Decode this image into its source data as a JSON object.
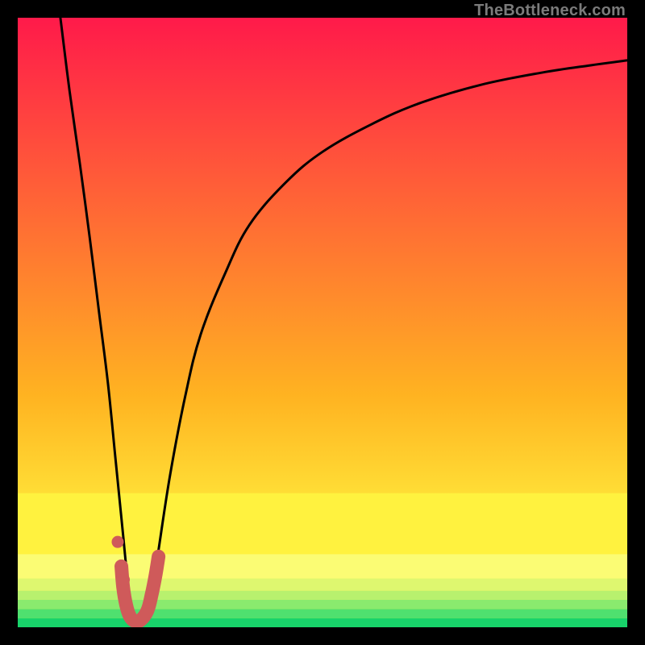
{
  "watermark": "TheBottleneck.com",
  "chart_data": {
    "type": "line",
    "title": "",
    "xlabel": "",
    "ylabel": "",
    "xlim": [
      0,
      100
    ],
    "ylim": [
      0,
      100
    ],
    "grid": false,
    "legend": false,
    "series": [
      {
        "name": "left-branch",
        "x": [
          7,
          8.5,
          10.2,
          11.8,
          13.3,
          14.8,
          16.0,
          17.2,
          18.0,
          18.8
        ],
        "y": [
          100,
          88,
          76,
          64,
          52,
          40,
          28,
          16,
          8,
          2
        ]
      },
      {
        "name": "right-branch",
        "x": [
          21.5,
          23,
          25,
          27.5,
          30,
          34,
          38,
          44,
          50,
          58,
          66,
          76,
          86,
          94,
          100
        ],
        "y": [
          2,
          12,
          25,
          38,
          48,
          58,
          66,
          73,
          78,
          82.5,
          86,
          89,
          91,
          92.2,
          93
        ]
      },
      {
        "name": "highlight-j",
        "x": [
          17.0,
          17.3,
          17.8,
          18.4,
          19.2,
          20.2,
          21.3,
          22.0,
          22.6,
          23.1
        ],
        "y": [
          10.0,
          6.5,
          3.6,
          1.8,
          1.0,
          1.2,
          2.8,
          5.5,
          8.5,
          11.6
        ]
      },
      {
        "name": "dot-upper",
        "x": [
          16.4
        ],
        "y": [
          14
        ]
      },
      {
        "name": "dot-lower",
        "x": [
          17.4
        ],
        "y": [
          7.8
        ]
      }
    ],
    "bands": [
      {
        "y0": 0,
        "y1": 1.5,
        "color": "#18d36a"
      },
      {
        "y0": 1.5,
        "y1": 3.0,
        "color": "#4fe06f"
      },
      {
        "y0": 3.0,
        "y1": 4.5,
        "color": "#8aea6e"
      },
      {
        "y0": 4.5,
        "y1": 6.0,
        "color": "#b8f16e"
      },
      {
        "y0": 6.0,
        "y1": 8.0,
        "color": "#def76f"
      },
      {
        "y0": 8.0,
        "y1": 12.0,
        "color": "#fbfc74"
      },
      {
        "y0": 12.0,
        "y1": 22.0,
        "color": "#fff23f"
      }
    ],
    "gradient_top": "#ff1a4a",
    "gradient_mid": "#ffb321",
    "gradient_low": "#fff23f",
    "highlight_color": "#cf5a5a",
    "curve_color": "#000000"
  }
}
